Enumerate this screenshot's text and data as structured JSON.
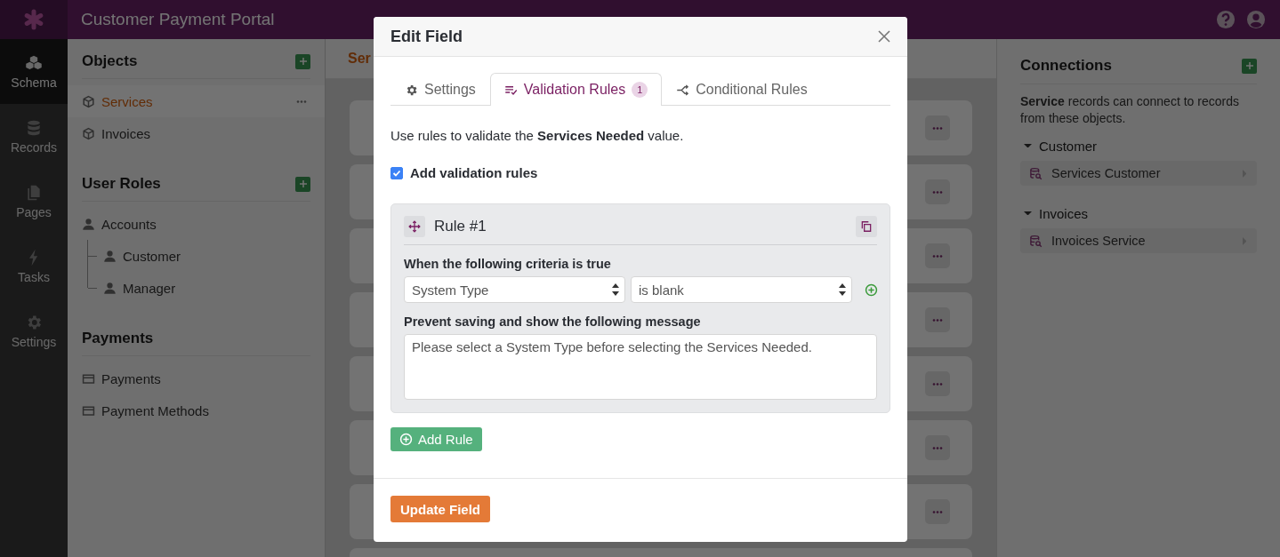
{
  "app": {
    "title": "Customer Payment Portal"
  },
  "nav": [
    {
      "label": "Schema",
      "kind": "schema",
      "selected": true
    },
    {
      "label": "Records",
      "kind": "records",
      "selected": false
    },
    {
      "label": "Pages",
      "kind": "pages",
      "selected": false
    },
    {
      "label": "Tasks",
      "kind": "tasks",
      "selected": false
    },
    {
      "label": "Settings",
      "kind": "settings",
      "selected": false
    }
  ],
  "objects_panel": {
    "sections": [
      {
        "title": "Objects",
        "add_button": true,
        "items": [
          {
            "label": "Services",
            "kind": "object",
            "selected": true
          },
          {
            "label": "Invoices",
            "kind": "object",
            "selected": false
          }
        ]
      },
      {
        "title": "User Roles",
        "add_button": true,
        "items": [
          {
            "label": "Accounts",
            "kind": "role",
            "selected": false,
            "children": [
              {
                "label": "Customer",
                "kind": "role",
                "selected": false
              },
              {
                "label": "Manager",
                "kind": "role",
                "selected": false
              }
            ]
          }
        ]
      },
      {
        "title": "Payments",
        "add_button": false,
        "items": [
          {
            "label": "Payments",
            "kind": "payment",
            "selected": false
          },
          {
            "label": "Payment Methods",
            "kind": "payment",
            "selected": false
          }
        ]
      }
    ]
  },
  "fields": {
    "header": "Ser",
    "rows": [
      {
        "kind": "field"
      },
      {
        "kind": "field"
      },
      {
        "kind": "field"
      },
      {
        "kind": "field"
      },
      {
        "kind": "field"
      },
      {
        "kind": "field"
      },
      {
        "kind": "field"
      },
      {
        "kind": "partial"
      }
    ]
  },
  "connections": {
    "title": "Connections",
    "description": "**Service** records can connect to records from these objects.",
    "groups": [
      {
        "label": "Customer",
        "expanded": true,
        "items": [
          "Services Customer"
        ]
      },
      {
        "label": "Invoices",
        "expanded": true,
        "items": [
          "Invoices Service"
        ]
      }
    ]
  },
  "dialog": {
    "title": "Edit Field",
    "tabs": [
      {
        "label": "Settings",
        "kind": "settings",
        "selected": false
      },
      {
        "label": "Validation Rules",
        "kind": "validation",
        "selected": true,
        "badge": "1"
      },
      {
        "label": "Conditional Rules",
        "kind": "conditional",
        "selected": false
      }
    ],
    "intro": "Use rules to validate the **Services Needed** value.",
    "enable": {
      "label": "Add validation rules",
      "checked": true
    },
    "rules": [
      {
        "title": "Rule #1",
        "criteria_label": "When the following criteria is true",
        "field": "System Type",
        "operator": "is blank",
        "message_label": "Prevent saving and show the following message",
        "message": "Please select a System Type before selecting the Services Needed."
      }
    ],
    "add_rule": "Add Rule",
    "submit": "Update Field"
  }
}
